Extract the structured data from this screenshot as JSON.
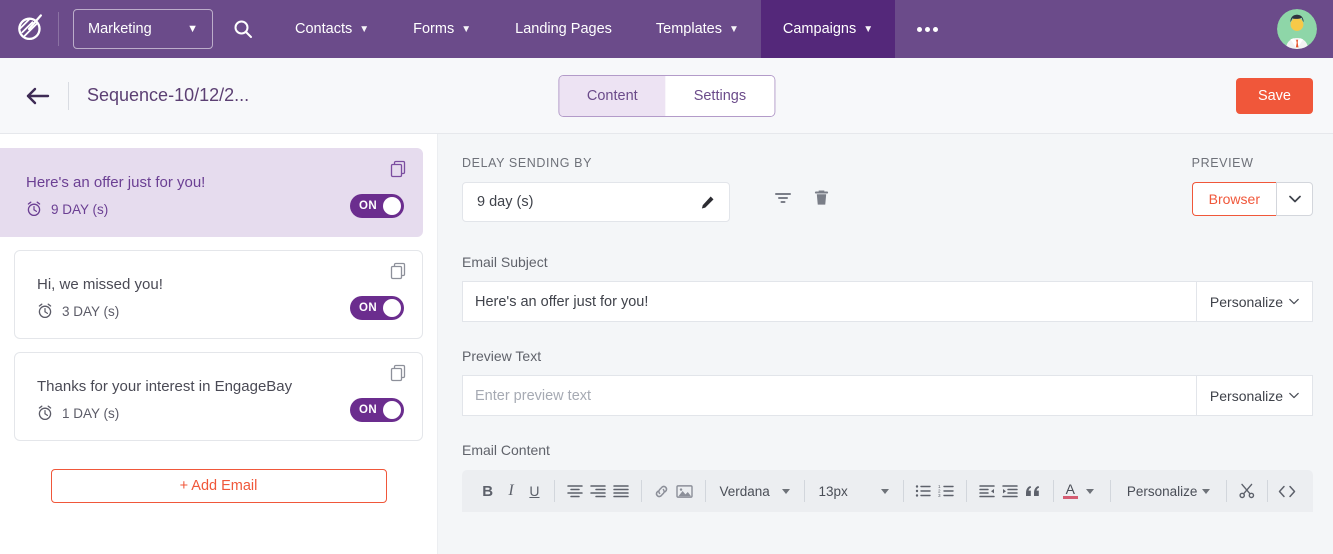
{
  "topnav": {
    "logo_icon": "engagebay-logo-icon",
    "module": {
      "label": "Marketing",
      "caret": "⌄"
    },
    "search_icon": "search-icon",
    "items": [
      {
        "label": "Contacts",
        "has_caret": true,
        "active": false
      },
      {
        "label": "Forms",
        "has_caret": true,
        "active": false
      },
      {
        "label": "Landing Pages",
        "has_caret": false,
        "active": false
      },
      {
        "label": "Templates",
        "has_caret": true,
        "active": false
      },
      {
        "label": "Campaigns",
        "has_caret": true,
        "active": true
      }
    ],
    "more_icon": "more-dots-icon",
    "avatar_icon": "user-avatar"
  },
  "subheader": {
    "back_icon": "back-arrow-icon",
    "title": "Sequence-10/12/2...",
    "tabs": [
      {
        "label": "Content",
        "active": true
      },
      {
        "label": "Settings",
        "active": false
      }
    ],
    "save_label": "Save"
  },
  "sidebar": {
    "emails": [
      {
        "title": "Here's an offer just for you!",
        "delay": "9 DAY (s)",
        "toggle": "ON",
        "selected": true
      },
      {
        "title": "Hi, we missed you!",
        "delay": "3 DAY (s)",
        "toggle": "ON",
        "selected": false
      },
      {
        "title": "Thanks for your interest in EngageBay",
        "delay": "1 DAY (s)",
        "toggle": "ON",
        "selected": false
      }
    ],
    "add_email_label": "+ Add Email",
    "copy_icon": "copy-icon",
    "clock_icon": "alarm-clock-icon"
  },
  "main": {
    "delay": {
      "label": "DELAY SENDING BY",
      "value": "9 day (s)",
      "edit_icon": "pencil-icon",
      "filter_icon": "filter-icon",
      "delete_icon": "trash-icon"
    },
    "preview": {
      "label": "PREVIEW",
      "button": "Browser",
      "caret_icon": "chevron-down-icon"
    },
    "subject": {
      "label": "Email Subject",
      "value": "Here's an offer just for you!",
      "personalize": "Personalize"
    },
    "preview_text": {
      "label": "Preview Text",
      "value": "",
      "placeholder": "Enter preview text",
      "personalize": "Personalize"
    },
    "content": {
      "label": "Email Content",
      "toolbar": {
        "bold": "B",
        "italic": "I",
        "underline": "U",
        "align_center_icon": "align-center-icon",
        "align_right_icon": "align-right-icon",
        "align_justify_icon": "align-justify-icon",
        "link_icon": "link-icon",
        "image_icon": "image-icon",
        "font_family": "Verdana",
        "font_size": "13px",
        "bullet_list_icon": "bullet-list-icon",
        "numbered_list_icon": "numbered-list-icon",
        "outdent_icon": "outdent-icon",
        "indent_icon": "indent-icon",
        "quote_icon": "blockquote-icon",
        "text_color_icon": "text-color-icon",
        "personalize": "Personalize",
        "cut_icon": "scissors-icon",
        "code_icon": "code-icon"
      }
    }
  },
  "colors": {
    "nav_purple": "#6B4B8A",
    "nav_active_purple": "#54287A",
    "accent_orange": "#F0573A",
    "toggle_purple": "#6B2D8E",
    "selected_card": "#E6DCEE"
  }
}
